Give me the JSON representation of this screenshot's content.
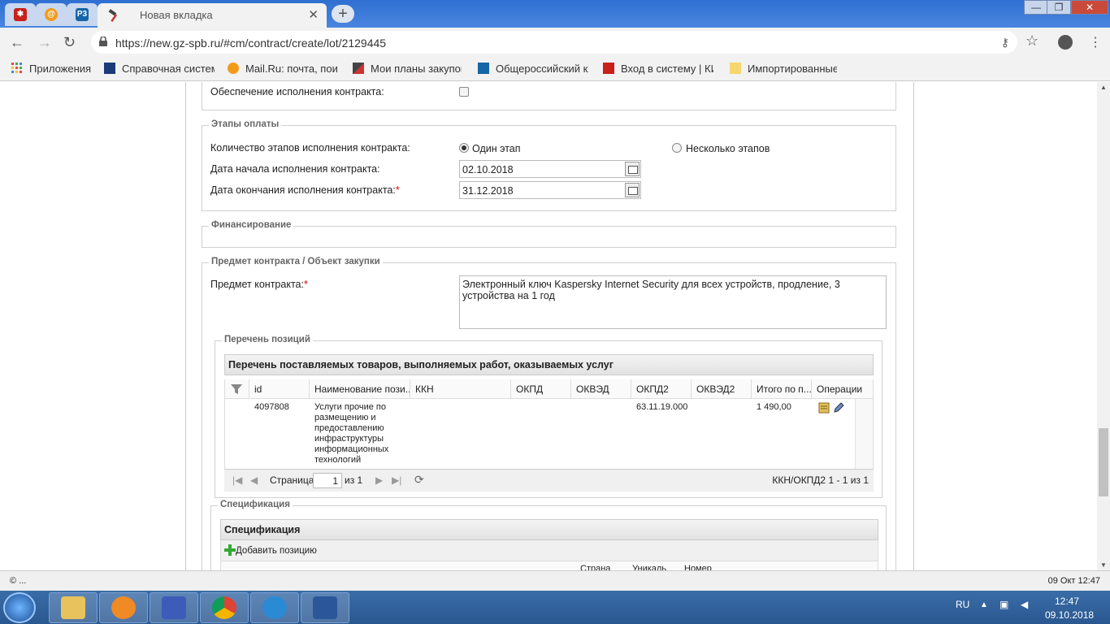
{
  "browser": {
    "active_tab_title": "Новая вкладка",
    "new_tab_glyph": "+",
    "tab_close_glyph": "✕",
    "url": "https://new.gz-spb.ru/#cm/contract/create/lot/2129445",
    "window_controls": {
      "minimize": "—",
      "maximize": "❐",
      "close": "✕"
    },
    "favicons": [
      "gerb-icon",
      "mailru-icon",
      "rz-icon",
      "hammer-icon"
    ]
  },
  "bookmarks": [
    {
      "label": "Приложения",
      "icon": "apps-grid-icon"
    },
    {
      "label": "Справочная система",
      "icon": "book-icon"
    },
    {
      "label": "Mail.Ru: почта, поиск",
      "icon": "mailru-icon"
    },
    {
      "label": "Мои планы закупок",
      "icon": "hammer-icon"
    },
    {
      "label": "Общероссийский кл",
      "icon": "rz-icon"
    },
    {
      "label": "Вход в систему | КИС",
      "icon": "gerb-icon"
    },
    {
      "label": "Импортированные",
      "icon": "folder-icon"
    }
  ],
  "form": {
    "security_label": "Обеспечение исполнения контракта:",
    "payment_stages": {
      "legend": "Этапы оплаты",
      "count_label": "Количество этапов исполнения контракта:",
      "option_one": "Один этап",
      "option_many": "Несколько этапов",
      "start_label": "Дата начала исполнения контракта:",
      "start_value": "02.10.2018",
      "end_label": "Дата окончания исполнения контракта:",
      "end_value": "31.12.2018",
      "required_mark": "*"
    },
    "financing": {
      "legend": "Финансирование"
    },
    "subject": {
      "legend": "Предмет контракта / Объект закупки",
      "label": "Предмет контракта:",
      "value": "Электронный ключ Kaspersky Internet Security для всех устройств, продление, 3 устройства на 1 год"
    },
    "positions": {
      "legend": "Перечень позиций",
      "grid_title": "Перечень поставляемых товаров, выполняемых работ, оказываемых услуг",
      "columns": [
        "id",
        "Наименование пози...",
        "ККН",
        "ОКПД",
        "ОКВЭД",
        "ОКПД2",
        "ОКВЭД2",
        "Итого по п...",
        "Операции"
      ],
      "rows": [
        {
          "id": "4097808",
          "name": "Услуги прочие по размещению и предоставлению инфраструктуры информационных технологий",
          "kkn": "",
          "okpd": "",
          "okved": "",
          "okpd2": "63.11.19.000",
          "okved2": "",
          "total": "1 490,00"
        }
      ],
      "pager": {
        "page_label": "Страница",
        "page": "1",
        "of_label": "из 1",
        "summary": "ККН/ОКПД2 1 - 1 из 1"
      }
    },
    "spec": {
      "legend": "Спецификация",
      "grid_title": "Спецификация",
      "add_label": "Добавить позицию",
      "partial_headers": [
        "Страна",
        "Уникаль",
        "Номер"
      ]
    }
  },
  "statusbar": {
    "left": "© ...",
    "right": "09 Окт 12:47"
  },
  "taskbar": {
    "lang": "RU",
    "time": "12:47",
    "date": "09.10.2018",
    "apps": [
      "explorer-icon",
      "media-player-icon",
      "save-icon",
      "chrome-icon",
      "ie-icon",
      "word-icon"
    ]
  },
  "colors": {
    "accent_blue": "#2f6fd1",
    "required_red": "#dd0000"
  }
}
